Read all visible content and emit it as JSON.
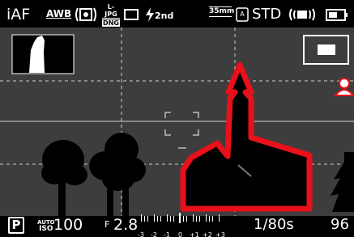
{
  "top_bar": {
    "focus_mode": "iAF",
    "white_balance": "AWB",
    "metering_icon": "spot-metering-icon",
    "file_format_top": "L-JPG",
    "file_format_bottom": "DNG",
    "drive_icon": "single-shot-icon",
    "flash_icon": "flash-icon",
    "flash_label": "2nd",
    "lens_focal": "35mm",
    "lens_icon": "lens-detect-icon",
    "film_style": "STD",
    "stabilization_icon": "stabilization-icon",
    "battery_icon": "battery-icon"
  },
  "viewfinder": {
    "histogram_icon": "histogram-icon",
    "focus_icon": "focus-frame-icon",
    "face_icon": "face-detect-icon",
    "subject_colors": {
      "focus_peaking": "#e8101a",
      "tree": "#000000",
      "background": "#3d3d3d",
      "grid": "#cfcfcf"
    }
  },
  "bottom_bar": {
    "exposure_mode": "P",
    "iso_auto_top": "AUTO",
    "iso_auto_bottom": "ISO",
    "iso_value": "100",
    "aperture_prefix": "F",
    "aperture_value": "2.8",
    "ev_scale": [
      "-3",
      "-2",
      "-1",
      "0",
      "+1",
      "+2",
      "+3"
    ],
    "shutter_speed": "1/80s",
    "shots_remaining": "96"
  }
}
